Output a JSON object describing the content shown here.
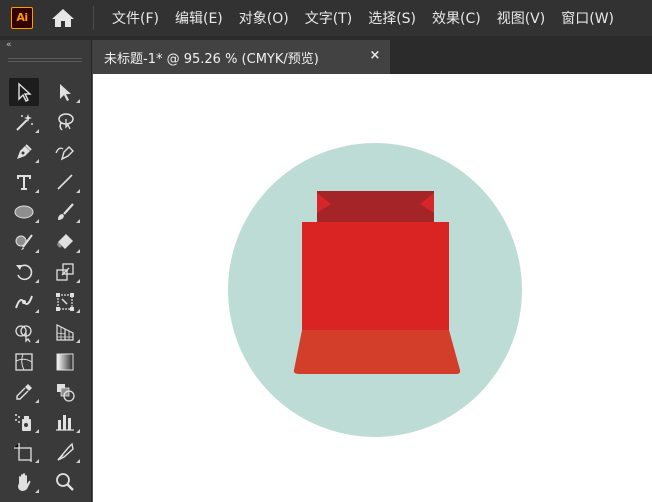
{
  "app": {
    "logo_text": "Ai",
    "logo_color": "#ff9a00"
  },
  "menu": {
    "items": [
      {
        "label": "文件(F)"
      },
      {
        "label": "编辑(E)"
      },
      {
        "label": "对象(O)"
      },
      {
        "label": "文字(T)"
      },
      {
        "label": "选择(S)"
      },
      {
        "label": "效果(C)"
      },
      {
        "label": "视图(V)"
      },
      {
        "label": "窗口(W)"
      }
    ]
  },
  "tools_panel": {
    "collapse_glyph": "«"
  },
  "tools": [
    "selection-tool-icon",
    "direct-selection-tool-icon",
    "magic-wand-tool-icon",
    "lasso-tool-icon",
    "pen-tool-icon",
    "curvature-tool-icon",
    "type-tool-icon",
    "line-segment-tool-icon",
    "ellipse-tool-icon",
    "paintbrush-tool-icon",
    "shaper-tool-icon",
    "eraser-tool-icon",
    "rotate-tool-icon",
    "scale-tool-icon",
    "width-tool-icon",
    "free-transform-tool-icon",
    "shape-builder-tool-icon",
    "perspective-grid-tool-icon",
    "mesh-tool-icon",
    "gradient-tool-icon",
    "eyedropper-tool-icon",
    "blend-tool-icon",
    "symbol-sprayer-tool-icon",
    "column-graph-tool-icon",
    "artboard-tool-icon",
    "slice-tool-icon",
    "hand-tool-icon",
    "zoom-tool-icon"
  ],
  "document_tab": {
    "title": "未标题-1* @ 95.26 % (CMYK/预览)",
    "close_glyph": "×"
  },
  "colors": {
    "circle": "#bedcd6",
    "bag_top": "#a52428",
    "bag_ear": "#d6262a",
    "bag_body": "#da2424",
    "bag_bottom": "#d33e2a"
  }
}
